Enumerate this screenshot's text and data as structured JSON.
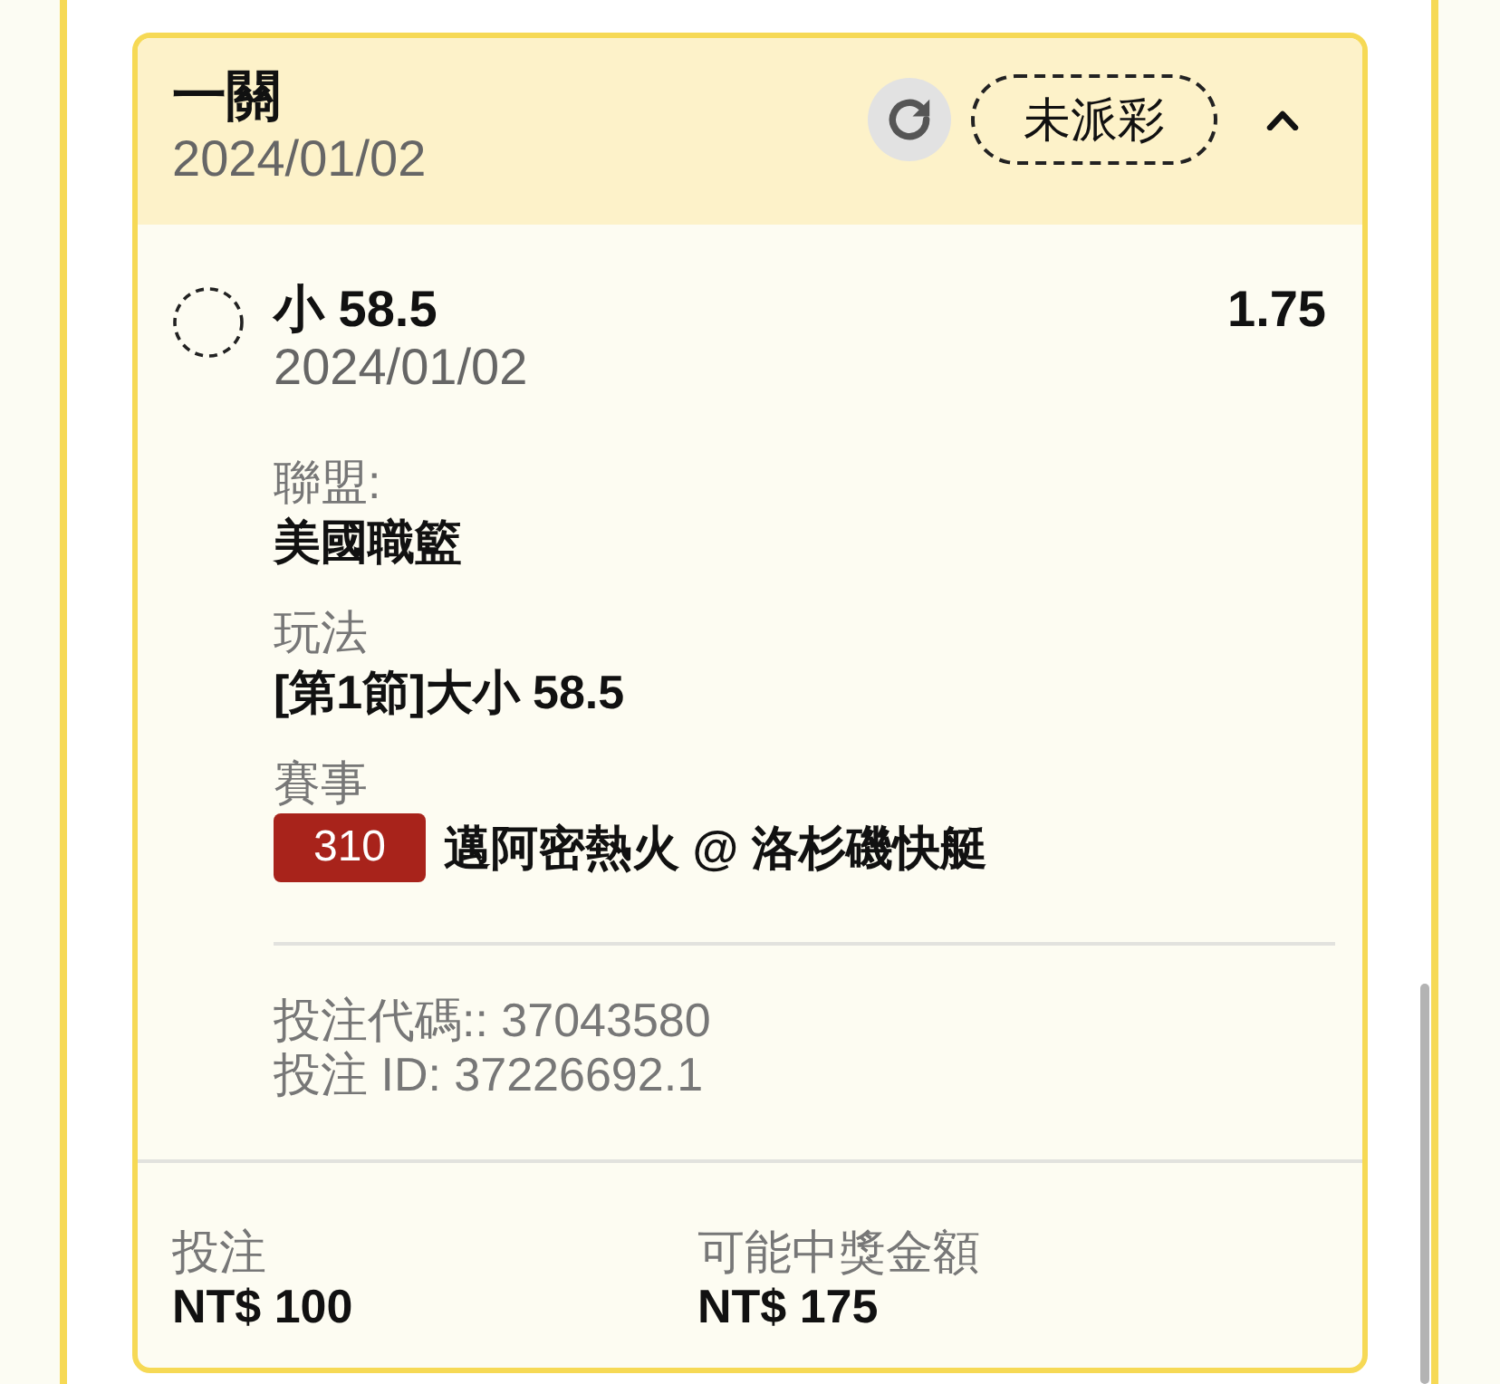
{
  "ticket": {
    "title": "一關",
    "date": "2024/01/02",
    "status": "未派彩",
    "expanded": true,
    "selection": {
      "name": "小 58.5",
      "odds": "1.75",
      "date": "2024/01/02"
    },
    "details": [
      {
        "label": "聯盟:",
        "value": "美國職籃"
      },
      {
        "label": "玩法",
        "value": "[第1節]大小 58.5"
      },
      {
        "label": "賽事",
        "badge": "310",
        "value": "邁阿密熱火 @ 洛杉磯快艇"
      }
    ],
    "codes": [
      "投注代碼:: 37043580",
      "投注 ID: 37226692.1"
    ],
    "summary": [
      {
        "label": "投注",
        "value": "NT$ 100"
      },
      {
        "label": "可能中獎金額",
        "value": "NT$ 175"
      }
    ]
  }
}
